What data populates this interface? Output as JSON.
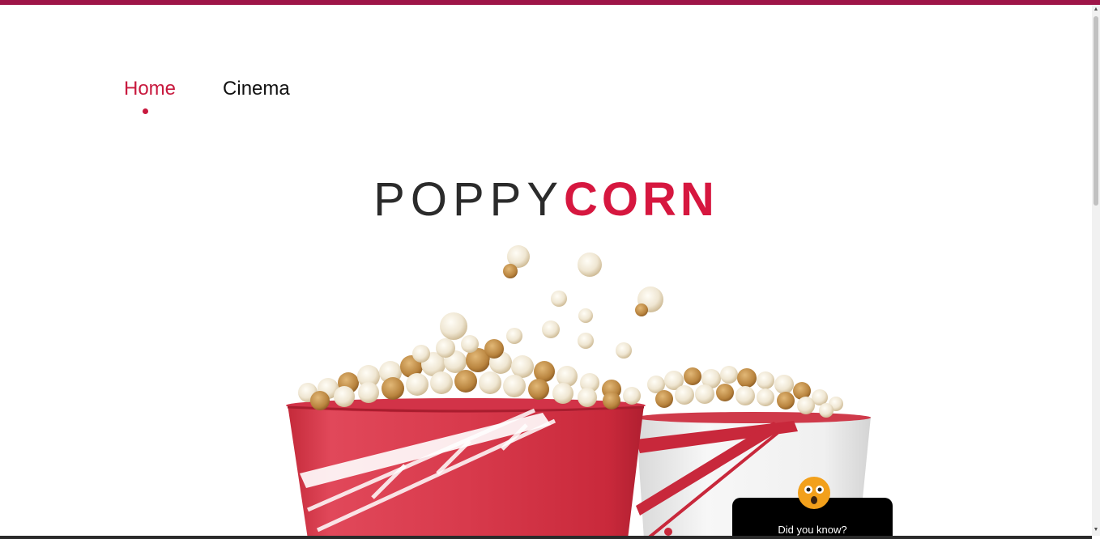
{
  "nav": {
    "items": [
      {
        "label": "Home",
        "active": true
      },
      {
        "label": "Cinema",
        "active": false
      }
    ]
  },
  "brand": {
    "part1": "POPPY",
    "part2": "CORN",
    "accent_color": "#d6173f",
    "dark_color": "#2b2b2b"
  },
  "hero": {
    "image": "popcorn-buckets-illustration"
  },
  "fact_widget": {
    "label": "Did you know?",
    "icon": "surprised-face-icon"
  },
  "colors": {
    "top_bar": "#9e1548",
    "nav_active": "#c8193e"
  }
}
